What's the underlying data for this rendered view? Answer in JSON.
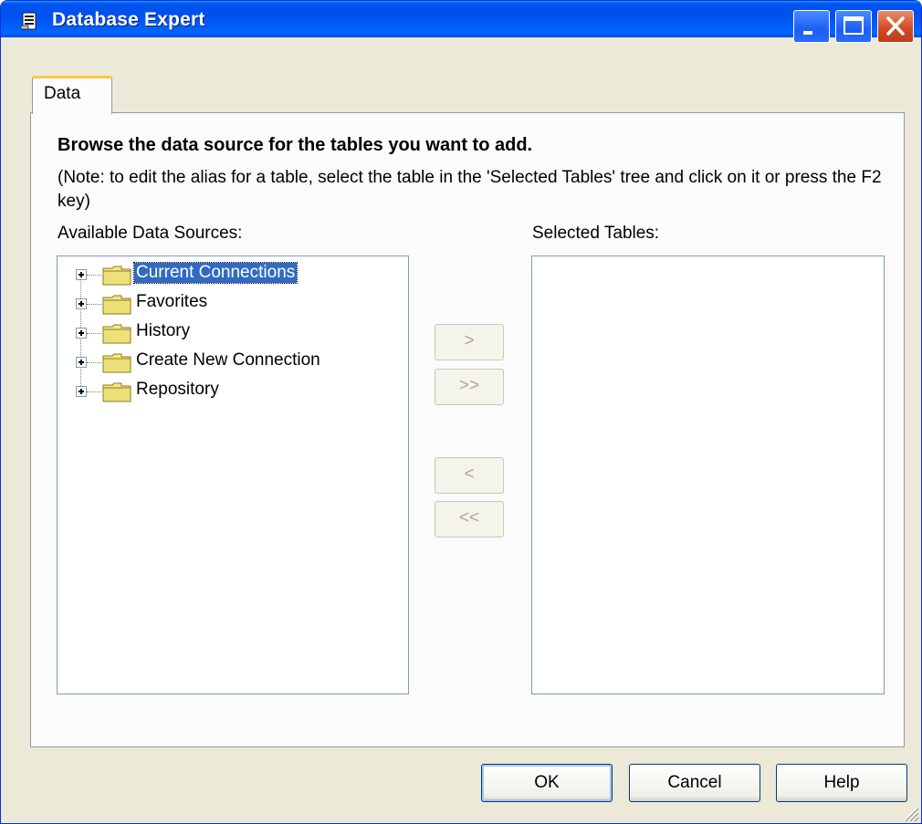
{
  "window": {
    "title": "Database Expert",
    "icon": "database-expert-icon",
    "controls": [
      "minimize-icon",
      "maximize-icon",
      "close-icon"
    ]
  },
  "tabs": [
    {
      "label": "Data",
      "active": true
    }
  ],
  "content": {
    "heading": "Browse the data source for the tables you want to add.",
    "note": "(Note: to edit the alias for a table, select the table in the 'Selected Tables' tree and click on it or press the F2 key)",
    "available_label": "Available Data Sources:",
    "selected_label": "Selected Tables:",
    "tree_items": [
      {
        "label": "Current Connections",
        "selected": true
      },
      {
        "label": "Favorites",
        "selected": false
      },
      {
        "label": "History",
        "selected": false
      },
      {
        "label": "Create New Connection",
        "selected": false
      },
      {
        "label": "Repository",
        "selected": false
      }
    ],
    "selected_tables": []
  },
  "move_buttons": {
    "add": ">",
    "add_all": ">>",
    "remove": "<",
    "remove_all": "<<"
  },
  "buttons": {
    "ok": "OK",
    "cancel": "Cancel",
    "help": "Help"
  },
  "colors": {
    "title_bar": "#0054e3",
    "selection": "#316ac5",
    "tab_highlight": "#ffc83c",
    "dialog_bg": "#ece9d8"
  }
}
